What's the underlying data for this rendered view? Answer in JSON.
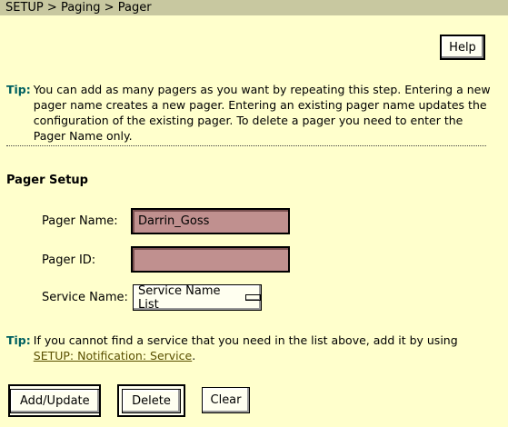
{
  "breadcrumb": {
    "part1": "SETUP",
    "sep1": ">",
    "part2": "Paging",
    "sep2": ">",
    "part3": "Pager"
  },
  "header": {
    "help_label": "Help"
  },
  "tip1": {
    "label": "Tip:",
    "text": "You can add as many pagers as you want by repeating this step. Entering a new pager name creates a new pager. Entering an existing pager name updates the configuration of the existing pager. To delete a pager you need to enter the Pager Name only."
  },
  "form": {
    "section_title": "Pager Setup",
    "pager_name_label": "Pager Name:",
    "pager_name_value": "Darrin_Goss",
    "pager_id_label": "Pager ID:",
    "pager_id_value": "",
    "service_name_label": "Service Name:",
    "service_name_selected": "Service Name List"
  },
  "tip2": {
    "label": "Tip:",
    "text_before": "If you cannot find a service that you need in the list above, add it by using ",
    "link_text": "SETUP: Notification: Service",
    "text_after": "."
  },
  "actions": {
    "add_update_label": "Add/Update",
    "delete_label": "Delete",
    "clear_label": "Clear"
  }
}
